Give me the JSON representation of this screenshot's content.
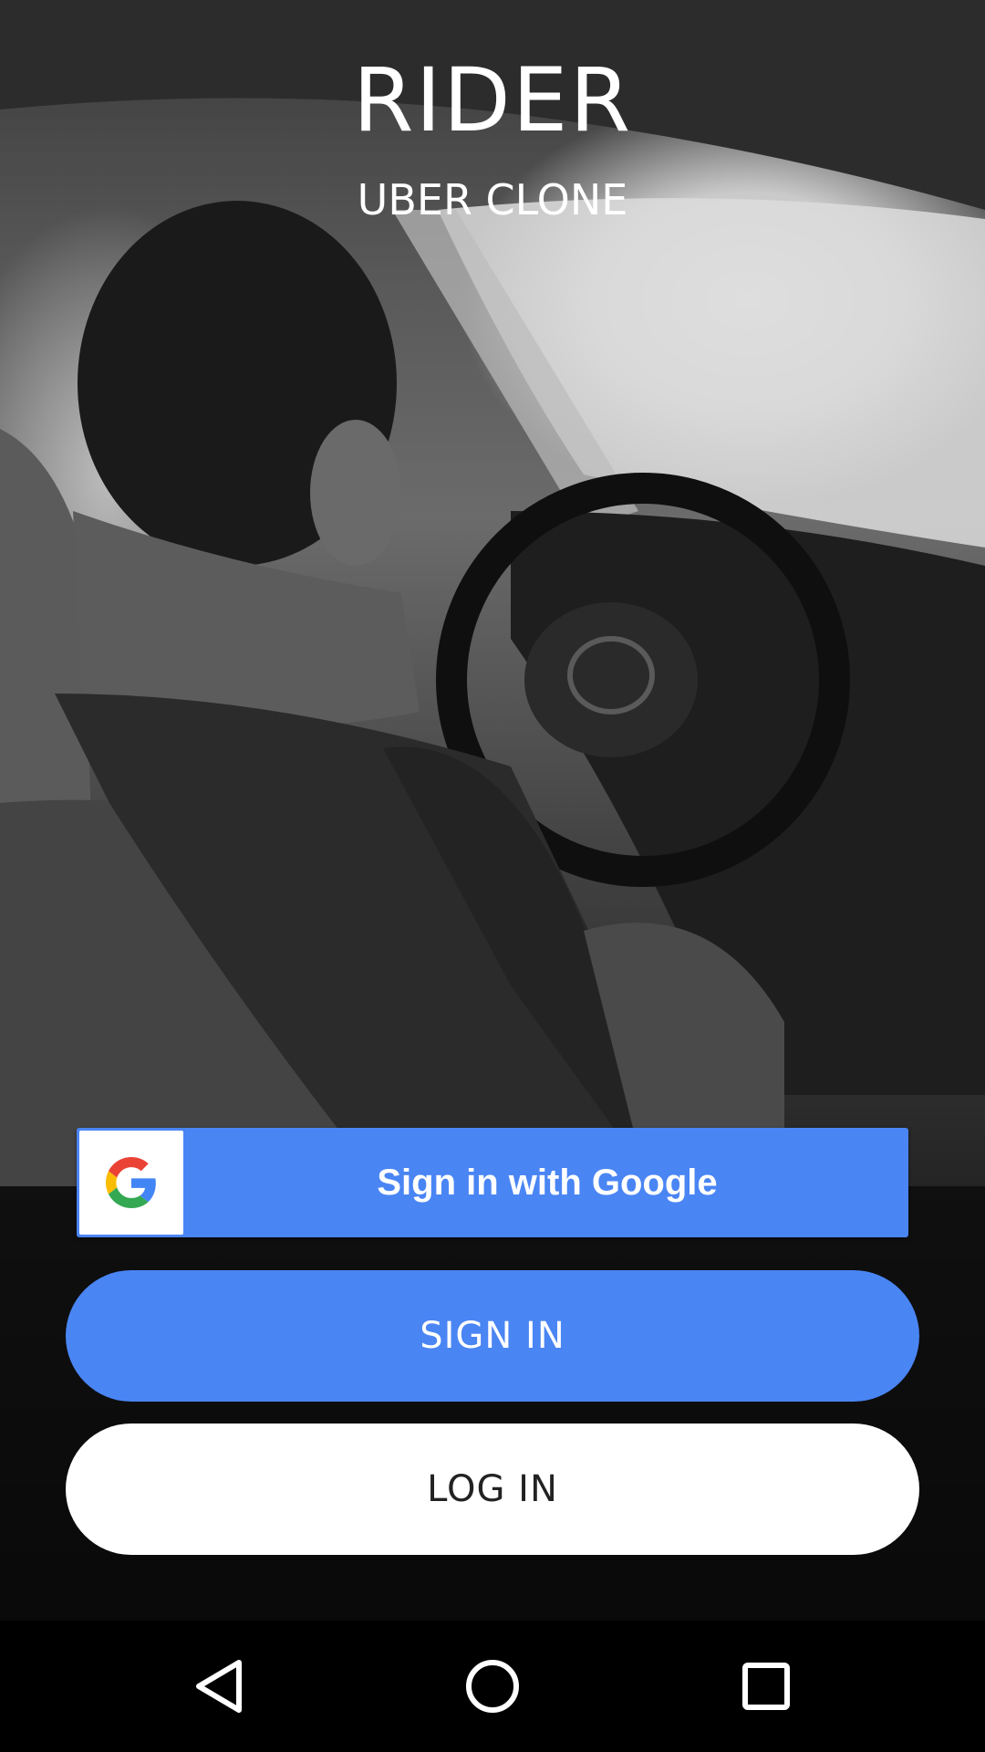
{
  "header": {
    "title": "RIDER",
    "subtitle": "UBER CLONE"
  },
  "actions": {
    "google_label": "Sign in with Google",
    "sign_in_label": "SIGN IN",
    "log_in_label": "LOG IN"
  },
  "navbar": {
    "back": "back-icon",
    "home": "home-icon",
    "recents": "recents-icon"
  },
  "colors": {
    "accent": "#4a85f4",
    "text_light": "#ffffff",
    "text_dark": "#222222",
    "navbar": "#000000"
  }
}
